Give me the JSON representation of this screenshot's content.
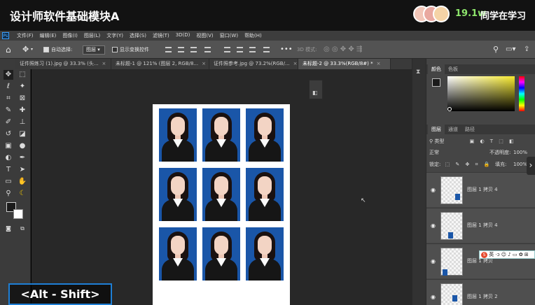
{
  "course": {
    "title": "设计师软件基础模块A",
    "learner_count": "19.1w",
    "learner_label": "同学在学习"
  },
  "app": {
    "logo": "Ps",
    "menu": [
      "文件(F)",
      "编辑(E)",
      "图像(I)",
      "图层(L)",
      "文字(Y)",
      "选择(S)",
      "滤镜(T)",
      "3D(D)",
      "视图(V)",
      "窗口(W)",
      "帮助(H)"
    ]
  },
  "options": {
    "auto_select_label": "自动选择:",
    "auto_select_value": "图层",
    "show_transform_label": "显示变换控件",
    "mode_3d_label": "3D 模式:"
  },
  "tabs": [
    {
      "label": "证件照练习 (1).jpg @ 33.3% (头...",
      "close": "×"
    },
    {
      "label": "未标题-1 @ 121% (图层 2, RGB/8...",
      "close": "×"
    },
    {
      "label": "证件照参考.jpg @ 73.2%(RGB/...",
      "close": "×"
    },
    {
      "label": "未标题-2 @ 33.3%(RGB/8#) *",
      "close": "×"
    }
  ],
  "color_panel": {
    "tabs": [
      "颜色",
      "色板"
    ]
  },
  "layers_panel": {
    "tabs": [
      "图层",
      "通道",
      "路径"
    ],
    "filter_label": "类型",
    "blend_mode": "正常",
    "opacity_label": "不透明度:",
    "opacity_value": "100%",
    "lock_label": "锁定:",
    "fill_label": "填充:",
    "fill_value": "100%",
    "layers": [
      {
        "name": "图层 1 拷贝 4"
      },
      {
        "name": "图层 1 拷贝 4"
      },
      {
        "name": "图层 1 拷贝"
      },
      {
        "name": "图层 1 拷贝 2"
      }
    ]
  },
  "ime": {
    "logo": "S",
    "lang": "英"
  },
  "keyboard_hint": "<Alt - Shift>",
  "photo_sheet": {
    "rows": 3,
    "cols": 3,
    "background_color": "#1a56a8"
  },
  "colors": {
    "accent_green": "#8ee66c",
    "hint_border": "#1e7fd6"
  }
}
